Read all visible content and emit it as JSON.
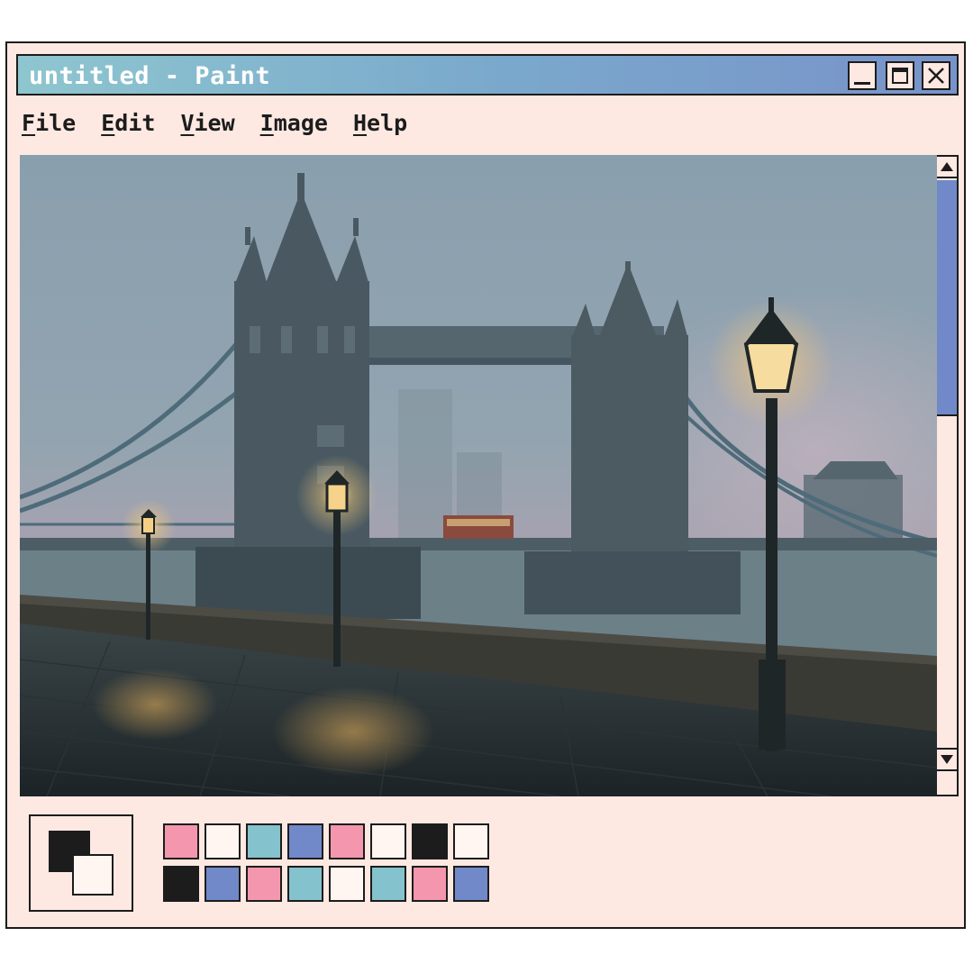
{
  "window": {
    "title": "untitled - Paint",
    "controls": {
      "minimize": "minimize-icon",
      "maximize": "maximize-icon",
      "close": "close-icon"
    }
  },
  "menu": [
    {
      "accel": "F",
      "rest": "ile"
    },
    {
      "accel": "E",
      "rest": "dit"
    },
    {
      "accel": "V",
      "rest": "iew"
    },
    {
      "accel": "I",
      "rest": "mage"
    },
    {
      "accel": "H",
      "rest": "elp"
    }
  ],
  "canvas": {
    "image": "Tower Bridge in fog at dusk with lit street lamps along a wet riverside walkway"
  },
  "scrollbar": {
    "up_icon": "arrow-up-icon",
    "down_icon": "arrow-down-icon"
  },
  "colors": {
    "foreground": "#1c1c1c",
    "background": "#fff5f1",
    "palette": [
      "#f497ae",
      "#fff5f1",
      "#84c2cd",
      "#7289c9",
      "#f497ae",
      "#fff5f1",
      "#1c1c1c",
      "#fff5f1",
      "#1c1c1c",
      "#7289c9",
      "#f497ae",
      "#84c2cd",
      "#fff5f1",
      "#84c2cd",
      "#f497ae",
      "#7289c9"
    ]
  }
}
